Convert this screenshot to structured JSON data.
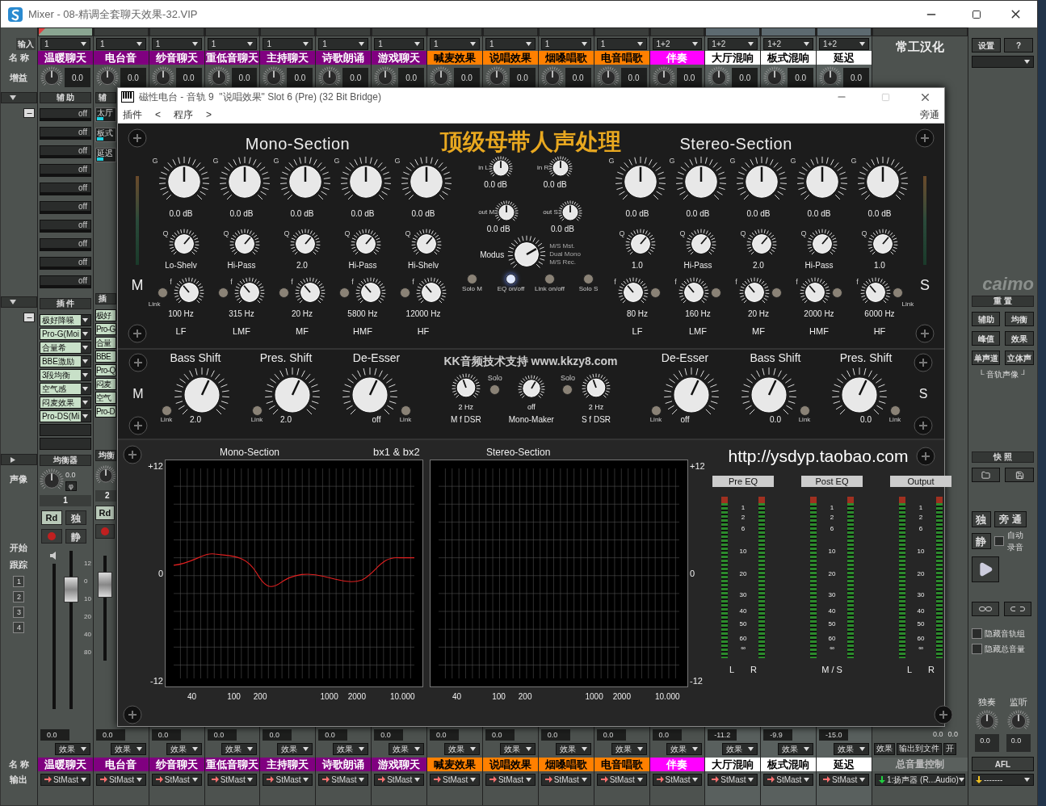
{
  "window": {
    "title": "Mixer - 08-精调全套聊天效果-32.VIP"
  },
  "row_labels": {
    "input": "输入",
    "name": "名 称",
    "gain": "增益",
    "pan": "声像",
    "start": "开始",
    "track": "跟踪",
    "name_bottom": "名 称",
    "output": "输出"
  },
  "track_buttons": [
    "1",
    "2",
    "3",
    "4"
  ],
  "channels": [
    {
      "input": "1",
      "name": "温暖聊天",
      "name_bottom": "温暖聊天",
      "color": "#800080",
      "gain": "0.0",
      "reading": "0.0",
      "effects": "效果",
      "output": "StMast",
      "kind": "audio",
      "selected": true
    },
    {
      "input": "1",
      "name": "电台音",
      "name_bottom": "电台音",
      "color": "#800080",
      "gain": "0.0",
      "reading": "0.0",
      "effects": "效果",
      "output": "StMast",
      "kind": "audio",
      "selected": false
    },
    {
      "input": "1",
      "name": "纱音聊天",
      "name_bottom": "纱音聊天",
      "color": "#800080",
      "gain": "0.0",
      "reading": "0.0",
      "effects": "效果",
      "output": "StMast",
      "kind": "audio",
      "selected": false
    },
    {
      "input": "1",
      "name": "重低音聊天",
      "name_bottom": "重低音聊天",
      "color": "#800080",
      "gain": "0.0",
      "reading": "0.0",
      "effects": "效果",
      "output": "StMast",
      "kind": "audio",
      "selected": false
    },
    {
      "input": "1",
      "name": "主持聊天",
      "name_bottom": "主持聊天",
      "color": "#800080",
      "gain": "0.0",
      "reading": "0.0",
      "effects": "效果",
      "output": "StMast",
      "kind": "audio",
      "selected": false
    },
    {
      "input": "1",
      "name": "诗歌朗诵",
      "name_bottom": "诗歌朗诵",
      "color": "#800080",
      "gain": "0.0",
      "reading": "0.0",
      "effects": "效果",
      "output": "StMast",
      "kind": "audio",
      "selected": false
    },
    {
      "input": "1",
      "name": "游戏聊天",
      "name_bottom": "游戏聊天",
      "color": "#800080",
      "gain": "0.0",
      "reading": "0.0",
      "effects": "效果",
      "output": "StMast",
      "kind": "audio",
      "selected": false
    },
    {
      "input": "1",
      "name": "喊麦效果",
      "name_bottom": "喊麦效果",
      "color": "#ff8000",
      "gain": "0.0",
      "reading": "0.0",
      "effects": "效果",
      "output": "StMast",
      "kind": "audio",
      "selected": false
    },
    {
      "input": "1",
      "name": "说唱效果",
      "name_bottom": "说唱效果",
      "color": "#ff8000",
      "gain": "0.0",
      "reading": "0.0",
      "effects": "效果",
      "output": "StMast",
      "kind": "audio",
      "selected": false
    },
    {
      "input": "1",
      "name": "烟嗓唱歌",
      "name_bottom": "烟嗓唱歌",
      "color": "#ff8000",
      "gain": "0.0",
      "reading": "0.0",
      "effects": "效果",
      "output": "StMast",
      "kind": "audio",
      "selected": false
    },
    {
      "input": "1",
      "name": "电音唱歌",
      "name_bottom": "电音唱歌",
      "color": "#ff8000",
      "gain": "0.0",
      "reading": "0.0",
      "effects": "效果",
      "output": "StMast",
      "kind": "audio",
      "selected": false
    },
    {
      "input": "1+2",
      "name": "伴奏",
      "name_bottom": "伴奏",
      "color": "#ff00ff",
      "gain": "0.0",
      "reading": "0.0",
      "effects": "效果",
      "output": "StMast",
      "kind": "audio",
      "selected": false
    },
    {
      "input": "1+2",
      "name": "大厅混响",
      "name_bottom": "大厅混响",
      "color": "#ffffff",
      "gain": "0.0",
      "reading": "-11.2",
      "effects": "效果",
      "output": "StMast",
      "kind": "fx",
      "selected": false
    },
    {
      "input": "1+2",
      "name": "板式混响",
      "name_bottom": "板式混响",
      "color": "#ffffff",
      "gain": "0.0",
      "reading": "-9.9",
      "effects": "效果",
      "output": "StMast",
      "kind": "fx",
      "selected": false
    },
    {
      "input": "1+2",
      "name": "延迟",
      "name_bottom": "延迟",
      "color": "#ffffff",
      "gain": "0.0",
      "reading": "-15.0",
      "effects": "效果",
      "output": "StMast",
      "kind": "fx",
      "selected": false
    }
  ],
  "strip_1": {
    "aux_header": "辅 助",
    "sends": [
      "off",
      "off",
      "off",
      "off",
      "off",
      "off",
      "off",
      "off",
      "off",
      "off"
    ],
    "insert_header": "插 件",
    "inserts": [
      "极好降噪",
      "Pro-G(Moi",
      "合量希",
      "BBE激励",
      "3段均衡",
      "空气感",
      "闷麦效果",
      "Pro-DS(Mi"
    ],
    "eq_header": "均衡器",
    "pan": "0.0",
    "phase": "φ",
    "number": "1",
    "rd": "Rd",
    "solo": "独",
    "mute": "静",
    "scale": [
      "12",
      "0",
      "10",
      "20",
      "40",
      "80"
    ]
  },
  "strip_2": {
    "aux_header": "辅",
    "sends": [
      "太厅",
      "板式",
      "延迟"
    ],
    "insert_header": "插",
    "inserts": [
      "极好",
      "Pro-G",
      "合量",
      "BBE",
      "Pro-Q",
      "闷麦",
      "空气",
      "Pro-D"
    ],
    "eq_header": "均衡",
    "number": "2",
    "rd": "Rd"
  },
  "master": {
    "brand": "常工汉化",
    "readings": [
      "0.0",
      "0.0"
    ],
    "effects": "效果",
    "to_file": "输出到文件",
    "on": "开",
    "name": "总音量控制",
    "output": "1:扬声器 (R...Audio)"
  },
  "right_panel": {
    "settings": "设置",
    "help": "?",
    "logo": "caimo",
    "reset_header": "重 置",
    "reset_buttons": [
      "辅助",
      "均衡",
      "峰值",
      "效果",
      "单声道",
      "立体声"
    ],
    "pan_caption": "└ 音轨声像 ┘",
    "snapshot_header": "快 照",
    "solo": "独",
    "bypass": "旁 通",
    "mute": "静",
    "auto_record": {
      "auto": "自动",
      "record": "录音",
      "checked": false
    },
    "hide_options": [
      {
        "label": "隐藏音轨组",
        "checked": false
      },
      {
        "label": "隐藏总音量",
        "checked": false
      }
    ],
    "solo_label": "独奏",
    "monitor_label": "监听",
    "knob_values": [
      "0.0",
      "0.0"
    ],
    "afl": "AFL",
    "output": "-------"
  },
  "plugin": {
    "title": "磁性电台 - 音轨 9  \"说唱效果\" Slot 6 (Pre) (32 Bit Bridge)",
    "menu": [
      "插件",
      "<",
      "程序",
      ">"
    ],
    "bypass": "旁通",
    "mono_heading": "Mono-Section",
    "brand": "顶级母带人声处理",
    "stereo_heading": "Stereo-Section",
    "eq_side": {
      "m": "M",
      "s": "S"
    },
    "dyn_side": {
      "m": "M",
      "s": "S"
    },
    "eq_links": [
      "Link",
      "Link"
    ],
    "mono_bands": [
      {
        "g": "G",
        "gain": "0.0 dB",
        "q_mark": "Q",
        "q": "Lo-Shelv",
        "f": "f",
        "freq": "100 Hz",
        "band": "LF"
      },
      {
        "g": "G",
        "gain": "0.0 dB",
        "q_mark": "Q",
        "q": "Hi-Pass",
        "f": "f",
        "freq": "315 Hz",
        "band": "LMF"
      },
      {
        "g": "G",
        "gain": "0.0 dB",
        "q_mark": "Q",
        "q": "2.0",
        "f": "f",
        "freq": "20 Hz",
        "band": "MF"
      },
      {
        "g": "G",
        "gain": "0.0 dB",
        "q_mark": "Q",
        "q": "Hi-Pass",
        "f": "f",
        "freq": "5800 Hz",
        "band": "HMF"
      },
      {
        "g": "G",
        "gain": "0.0 dB",
        "q_mark": "Q",
        "q": "Hi-Shelv",
        "f": "f",
        "freq": "12000 Hz",
        "band": "HF"
      }
    ],
    "stereo_bands": [
      {
        "g": "G",
        "gain": "0.0 dB",
        "q_mark": "Q",
        "q": "1.0",
        "f": "f",
        "freq": "80 Hz",
        "band": "LF"
      },
      {
        "g": "G",
        "gain": "0.0 dB",
        "q_mark": "Q",
        "q": "Hi-Pass",
        "f": "f",
        "freq": "160 Hz",
        "band": "LMF"
      },
      {
        "g": "G",
        "gain": "0.0 dB",
        "q_mark": "Q",
        "q": "2.0",
        "f": "f",
        "freq": "20 Hz",
        "band": "MF"
      },
      {
        "g": "G",
        "gain": "0.0 dB",
        "q_mark": "Q",
        "q": "Hi-Pass",
        "f": "f",
        "freq": "2000 Hz",
        "band": "HMF"
      },
      {
        "g": "G",
        "gain": "0.0 dB",
        "q_mark": "Q",
        "q": "1.0",
        "f": "f",
        "freq": "6000 Hz",
        "band": "HF"
      }
    ],
    "io": [
      {
        "label": "in L",
        "value": "0.0 dB"
      },
      {
        "label": "in R",
        "value": "0.0 dB"
      },
      {
        "label": "out M",
        "value": "0.0 dB"
      },
      {
        "label": "out S",
        "value": "0.0 dB"
      }
    ],
    "modus": {
      "label": "Modus",
      "options": [
        "M/S Mst.",
        "Dual Mono",
        "M/S Rec."
      ]
    },
    "center_buttons": [
      {
        "label": "Solo M",
        "on": false
      },
      {
        "label": "EQ on/off",
        "on": true
      },
      {
        "label": "Link on/off",
        "on": false
      },
      {
        "label": "Solo S",
        "on": false
      }
    ],
    "dynamics_left": [
      {
        "label": "Bass Shift",
        "value": "2.0",
        "link": "Link"
      },
      {
        "label": "Pres. Shift",
        "value": "2.0",
        "link": "Link"
      },
      {
        "label": "De-Esser",
        "value": "off",
        "link": "Link"
      }
    ],
    "dynamics_right": [
      {
        "label": "De-Esser",
        "value": "off",
        "link": "Link"
      },
      {
        "label": "Bass Shift",
        "value": "0.0",
        "link": "Link"
      },
      {
        "label": "Pres. Shift",
        "value": "0.0",
        "link": "Link"
      }
    ],
    "watermark_line": "KK音频技术支持 www.kkzy8.com",
    "center_dyn": {
      "m_dsr": {
        "value": "2 Hz",
        "label": "M f DSR"
      },
      "s_dsr": {
        "value": "2 Hz",
        "label": "S f DSR"
      },
      "solo_left": "Solo",
      "solo_right": "Solo",
      "mono_maker": {
        "value": "off",
        "label": "Mono-Maker"
      }
    },
    "graph_titles": [
      "Mono-Section",
      "bx1 & bx2",
      "Stereo-Section"
    ],
    "left_y_labels": [
      "+12",
      "0",
      "-12"
    ],
    "right_y_labels": [
      "+12",
      "0",
      "-12"
    ],
    "graphs": [
      {
        "x_labels": [
          "40",
          "100",
          "200",
          "1000",
          "2000",
          "10.000"
        ]
      },
      {
        "x_labels": [
          "40",
          "100",
          "200",
          "1000",
          "2000",
          "10.000"
        ]
      }
    ],
    "url": "http://ysdyp.taobao.com",
    "meters": [
      {
        "title": "Pre EQ",
        "footer": [
          "L",
          "R"
        ],
        "scale": [
          "1",
          "2",
          "6",
          "10",
          "20",
          "30",
          "40",
          "50",
          "60",
          "∞"
        ]
      },
      {
        "title": "Post EQ",
        "footer": [
          "M / S"
        ],
        "scale": [
          "1",
          "2",
          "6",
          "10",
          "20",
          "30",
          "40",
          "50",
          "60",
          "∞"
        ]
      },
      {
        "title": "Output",
        "footer": [
          "L",
          "R"
        ],
        "scale": [
          "1",
          "2",
          "6",
          "10",
          "20",
          "30",
          "40",
          "50",
          "60",
          "∞"
        ]
      }
    ]
  }
}
